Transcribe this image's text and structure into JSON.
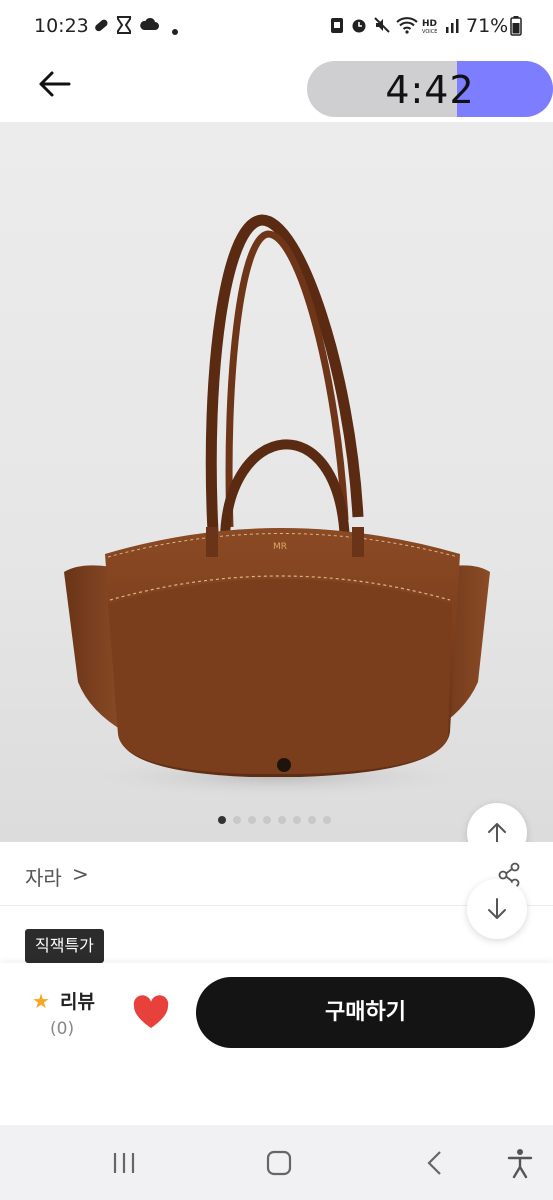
{
  "status_bar": {
    "time": "10:23",
    "battery": "71%",
    "icons": [
      "pill-icon",
      "hourglass-icon",
      "cloud-icon",
      "dot-icon",
      "vpn-icon",
      "alarm-icon",
      "mute-icon",
      "wifi-icon",
      "hd-voice-icon",
      "signal-icon",
      "battery-icon"
    ]
  },
  "header": {
    "timer": "4:42",
    "timer_progress": 0.39
  },
  "product": {
    "image_alt": "brown leather tote bag",
    "monogram": "MR",
    "pager_total": 8,
    "pager_active": 0
  },
  "brand": {
    "name": "자라",
    "chevron": ">"
  },
  "tag": "직잭특가",
  "bottom": {
    "review_label": "리뷰",
    "review_count": "(0)",
    "buy_label": "구매하기"
  },
  "colors": {
    "accent": "#7d7dff",
    "heart": "#e8413c",
    "star": "#f5a623",
    "buy_button": "#141414"
  }
}
